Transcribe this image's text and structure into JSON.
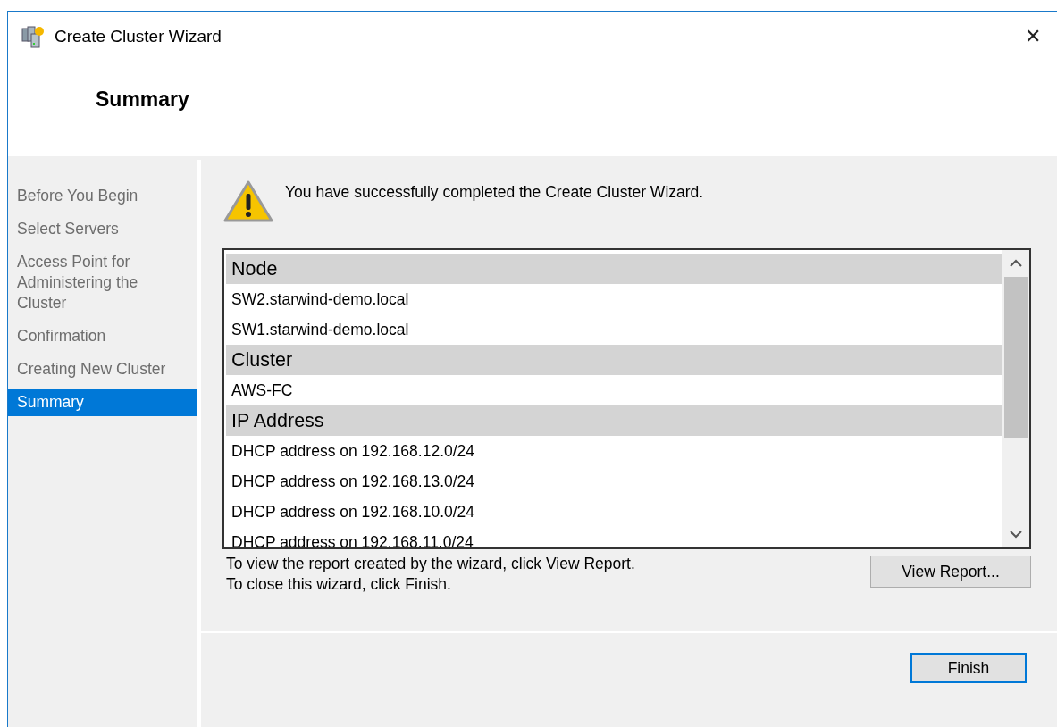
{
  "window": {
    "title": "Create Cluster Wizard",
    "close": "✕"
  },
  "page_title": "Summary",
  "steps": [
    {
      "label": "Before You Begin",
      "selected": false
    },
    {
      "label": "Select Servers",
      "selected": false
    },
    {
      "label": "Access Point for Administering the Cluster",
      "selected": false
    },
    {
      "label": "Confirmation",
      "selected": false
    },
    {
      "label": "Creating New Cluster",
      "selected": false
    },
    {
      "label": "Summary",
      "selected": true
    }
  ],
  "message": "You have successfully completed the Create Cluster Wizard.",
  "summary_list": [
    {
      "kind": "header",
      "text": "Node"
    },
    {
      "kind": "item",
      "text": "SW2.starwind-demo.local"
    },
    {
      "kind": "item",
      "text": "SW1.starwind-demo.local"
    },
    {
      "kind": "header",
      "text": "Cluster"
    },
    {
      "kind": "item",
      "text": "AWS-FC"
    },
    {
      "kind": "header",
      "text": "IP Address"
    },
    {
      "kind": "item",
      "text": "DHCP address on 192.168.12.0/24"
    },
    {
      "kind": "item",
      "text": "DHCP address on 192.168.13.0/24"
    },
    {
      "kind": "item",
      "text": "DHCP address on 192.168.10.0/24"
    },
    {
      "kind": "item",
      "text": "DHCP address on 192.168.11.0/24"
    }
  ],
  "hints": [
    "To view the report created by the wizard, click View Report.",
    "To close this wizard, click Finish."
  ],
  "view_report_button": "View Report...",
  "finish_button": "Finish"
}
